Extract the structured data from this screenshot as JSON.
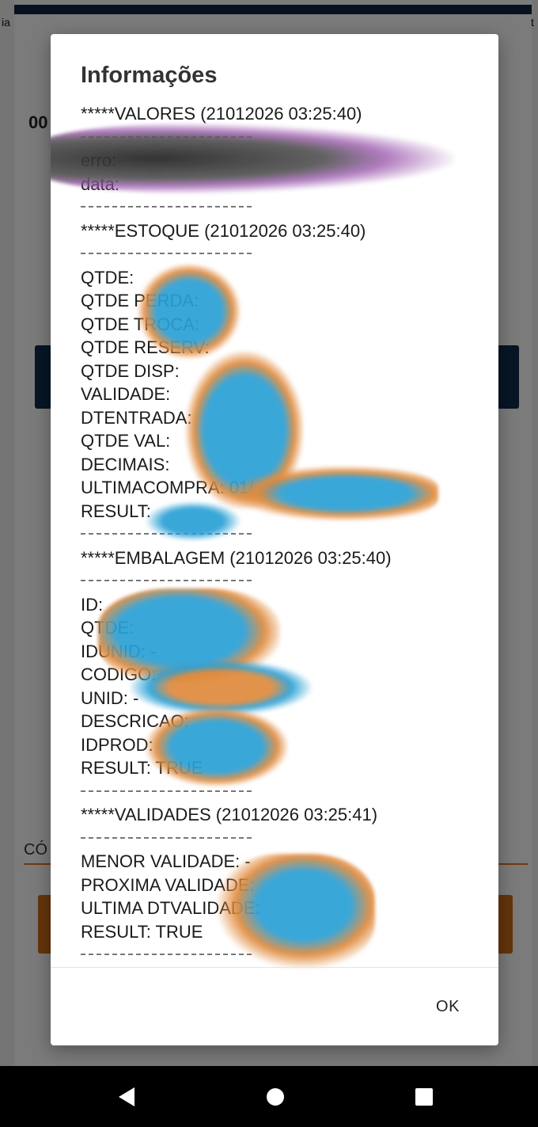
{
  "background_app": {
    "edge_left_text": "ia",
    "edge_right_text": "t",
    "header_number": "00",
    "code_label": "CÓ"
  },
  "dialog": {
    "title": "Informações",
    "lines": [
      {
        "kind": "text",
        "text": "*****VALORES (21012026 03:25:40)"
      },
      {
        "kind": "sep"
      },
      {
        "kind": "text",
        "text": "erro: "
      },
      {
        "kind": "text",
        "text": "data: "
      },
      {
        "kind": "sep"
      },
      {
        "kind": "text",
        "text": "*****ESTOQUE (21012026 03:25:40)"
      },
      {
        "kind": "sep"
      },
      {
        "kind": "text",
        "text": "QTDE: "
      },
      {
        "kind": "text",
        "text": "QTDE PERDA: "
      },
      {
        "kind": "text",
        "text": "QTDE TROCA: "
      },
      {
        "kind": "text",
        "text": "QTDE RESERV: "
      },
      {
        "kind": "text",
        "text": "QTDE DISP: "
      },
      {
        "kind": "text",
        "text": "VALIDADE: "
      },
      {
        "kind": "text",
        "text": "DTENTRADA: "
      },
      {
        "kind": "text",
        "text": "QTDE VAL: "
      },
      {
        "kind": "text",
        "text": "DECIMAIS: "
      },
      {
        "kind": "text",
        "text": "ULTIMACOMPRA: 01/"
      },
      {
        "kind": "text",
        "text": "RESULT: "
      },
      {
        "kind": "sep"
      },
      {
        "kind": "text",
        "text": "*****EMBALAGEM (21012026 03:25:40)"
      },
      {
        "kind": "sep"
      },
      {
        "kind": "text",
        "text": "ID: "
      },
      {
        "kind": "text",
        "text": "QTDE: "
      },
      {
        "kind": "text",
        "text": "IDUNID: -"
      },
      {
        "kind": "text",
        "text": "CODIGO: "
      },
      {
        "kind": "text",
        "text": "UNID: -"
      },
      {
        "kind": "text",
        "text": "DESCRICAO: "
      },
      {
        "kind": "text",
        "text": "IDPROD: "
      },
      {
        "kind": "text",
        "text": "RESULT: TRUE"
      },
      {
        "kind": "sep"
      },
      {
        "kind": "text",
        "text": "*****VALIDADES (21012026 03:25:41)"
      },
      {
        "kind": "sep"
      },
      {
        "kind": "text",
        "text": "MENOR VALIDADE: -"
      },
      {
        "kind": "text",
        "text": "PROXIMA VALIDADE: "
      },
      {
        "kind": "text",
        "text": "ULTIMA DTVALIDADE: "
      },
      {
        "kind": "text",
        "text": "RESULT: TRUE"
      },
      {
        "kind": "sep"
      }
    ],
    "ok_label": "OK"
  },
  "navbar": {
    "back_icon": "back-triangle-icon",
    "home_icon": "home-circle-icon",
    "recent_icon": "recent-square-icon"
  }
}
